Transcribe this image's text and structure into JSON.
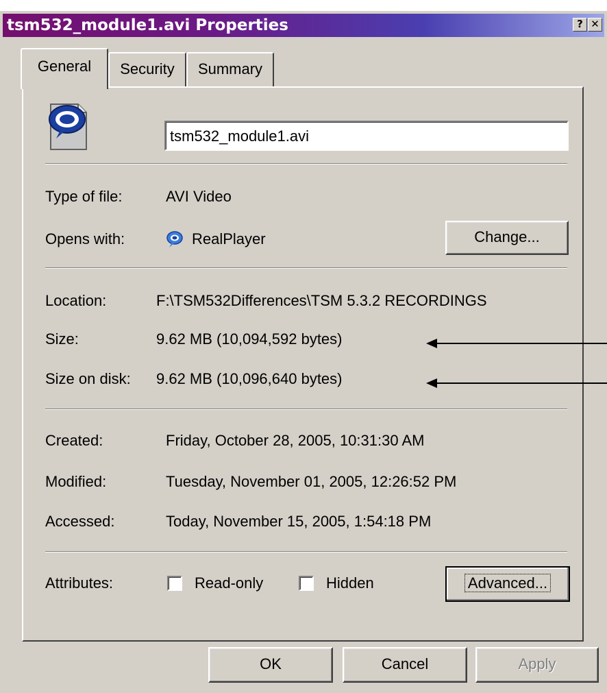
{
  "window": {
    "title": "tsm532_module1.avi Properties",
    "help_glyph": "?",
    "close_glyph": "✕"
  },
  "tabs": [
    {
      "label": "General"
    },
    {
      "label": "Security"
    },
    {
      "label": "Summary"
    }
  ],
  "general": {
    "file_name": "tsm532_module1.avi",
    "file_icon": "realplayer-file-icon",
    "type_label": "Type of file:",
    "type_value": "AVI Video",
    "opens_label": "Opens with:",
    "opens_value": "RealPlayer",
    "opens_icon": "realplayer-icon",
    "change_button": "Change...",
    "location_label": "Location:",
    "location_value": "F:\\TSM532Differences\\TSM 5.3.2 RECORDINGS",
    "size_label": "Size:",
    "size_value": "9.62 MB (10,094,592 bytes)",
    "size_on_disk_label": "Size on disk:",
    "size_on_disk_value": "9.62 MB (10,096,640 bytes)",
    "created_label": "Created:",
    "created_value": "Friday, October 28, 2005, 10:31:30 AM",
    "modified_label": "Modified:",
    "modified_value": "Tuesday, November 01, 2005, 12:26:52 PM",
    "accessed_label": "Accessed:",
    "accessed_value": "Today, November 15, 2005, 1:54:18 PM",
    "attributes_label": "Attributes:",
    "readonly_label": "Read-only",
    "readonly_checked": false,
    "hidden_label": "Hidden",
    "hidden_checked": false,
    "advanced_button": "Advanced..."
  },
  "footer": {
    "ok": "OK",
    "cancel": "Cancel",
    "apply": "Apply"
  }
}
